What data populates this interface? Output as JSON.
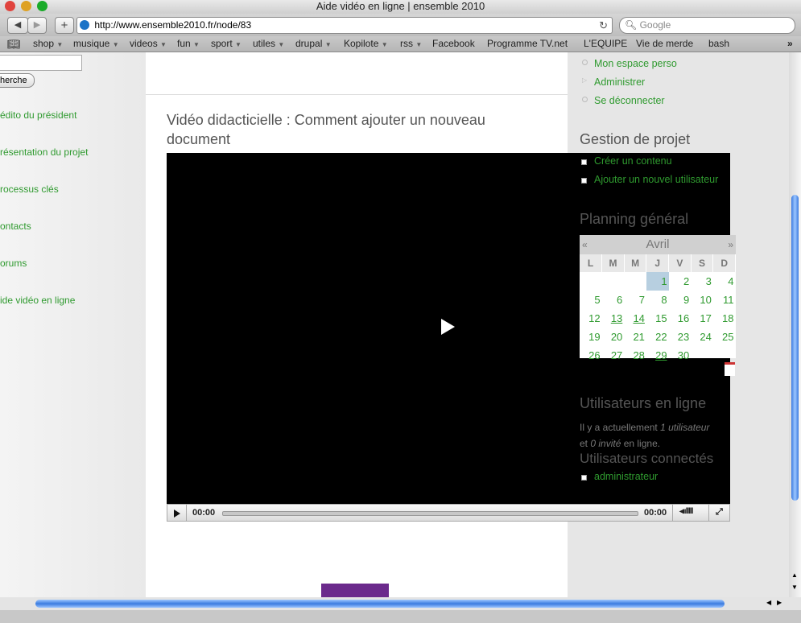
{
  "window": {
    "title": "Aide vidéo en ligne | ensemble 2010"
  },
  "toolbar": {
    "back_icon": "back-arrow-icon",
    "forward_icon": "forward-arrow-icon",
    "add_icon": "plus-icon",
    "url": "http://www.ensemble2010.fr/node/83",
    "search_placeholder": "Google"
  },
  "bookmarks": [
    {
      "label": "shop",
      "menu": true
    },
    {
      "label": "musique",
      "menu": true
    },
    {
      "label": "videos",
      "menu": true
    },
    {
      "label": "fun",
      "menu": true
    },
    {
      "label": "sport",
      "menu": true
    },
    {
      "label": "utiles",
      "menu": true
    },
    {
      "label": "drupal",
      "menu": true
    },
    {
      "label": "Kopilote",
      "menu": true
    },
    {
      "label": "rss",
      "menu": true
    },
    {
      "label": "Facebook",
      "menu": false
    },
    {
      "label": "Programme TV.net",
      "menu": false
    },
    {
      "label": "L'EQUIPE",
      "menu": false
    },
    {
      "label": "Vie de merde",
      "menu": false
    },
    {
      "label": "bash",
      "menu": false
    }
  ],
  "left": {
    "search_button": "herche",
    "nav": [
      "édito du président",
      "résentation du projet",
      "rocessus clés",
      "ontacts",
      "orums",
      "ide vidéo en ligne"
    ]
  },
  "main": {
    "title_line1": "Vidéo didacticielle : Comment ajouter un nouveau",
    "title_line2": "document",
    "player": {
      "time_current": "00:00",
      "time_total": "00:00",
      "progress": 0
    }
  },
  "sidebar": {
    "user_menu": [
      "Mon espace perso",
      "Administrer",
      "Se déconnecter"
    ],
    "gestion_title": "Gestion de projet",
    "gestion_items": [
      "Créer un contenu",
      "Ajouter un nouvel utilisateur"
    ],
    "planning_title": "Planning général",
    "calendar": {
      "month": "Avril",
      "prev": "«",
      "next": "»",
      "days": [
        "L",
        "M",
        "M",
        "J",
        "V",
        "S",
        "D"
      ],
      "weeks": [
        [
          "",
          "",
          "",
          "1",
          "2",
          "3",
          "4"
        ],
        [
          "5",
          "6",
          "7",
          "8",
          "9",
          "10",
          "11"
        ],
        [
          "12",
          "13",
          "14",
          "15",
          "16",
          "17",
          "18"
        ],
        [
          "19",
          "20",
          "21",
          "22",
          "23",
          "24",
          "25"
        ],
        [
          "26",
          "27",
          "28",
          "29",
          "30",
          "",
          ""
        ]
      ],
      "today": "1",
      "linked": [
        "13",
        "14",
        "29"
      ]
    },
    "online_title": "Utilisateurs en ligne",
    "online_text1_a": "Il y a actuellement ",
    "online_text1_b": "1 utilisateur",
    "online_text2_a": "0 invité",
    "online_text2_b": " en ligne.",
    "online_text2_pre": "et ",
    "connected_title": "Utilisateurs connectés",
    "connected_users": [
      "administrateur"
    ]
  }
}
